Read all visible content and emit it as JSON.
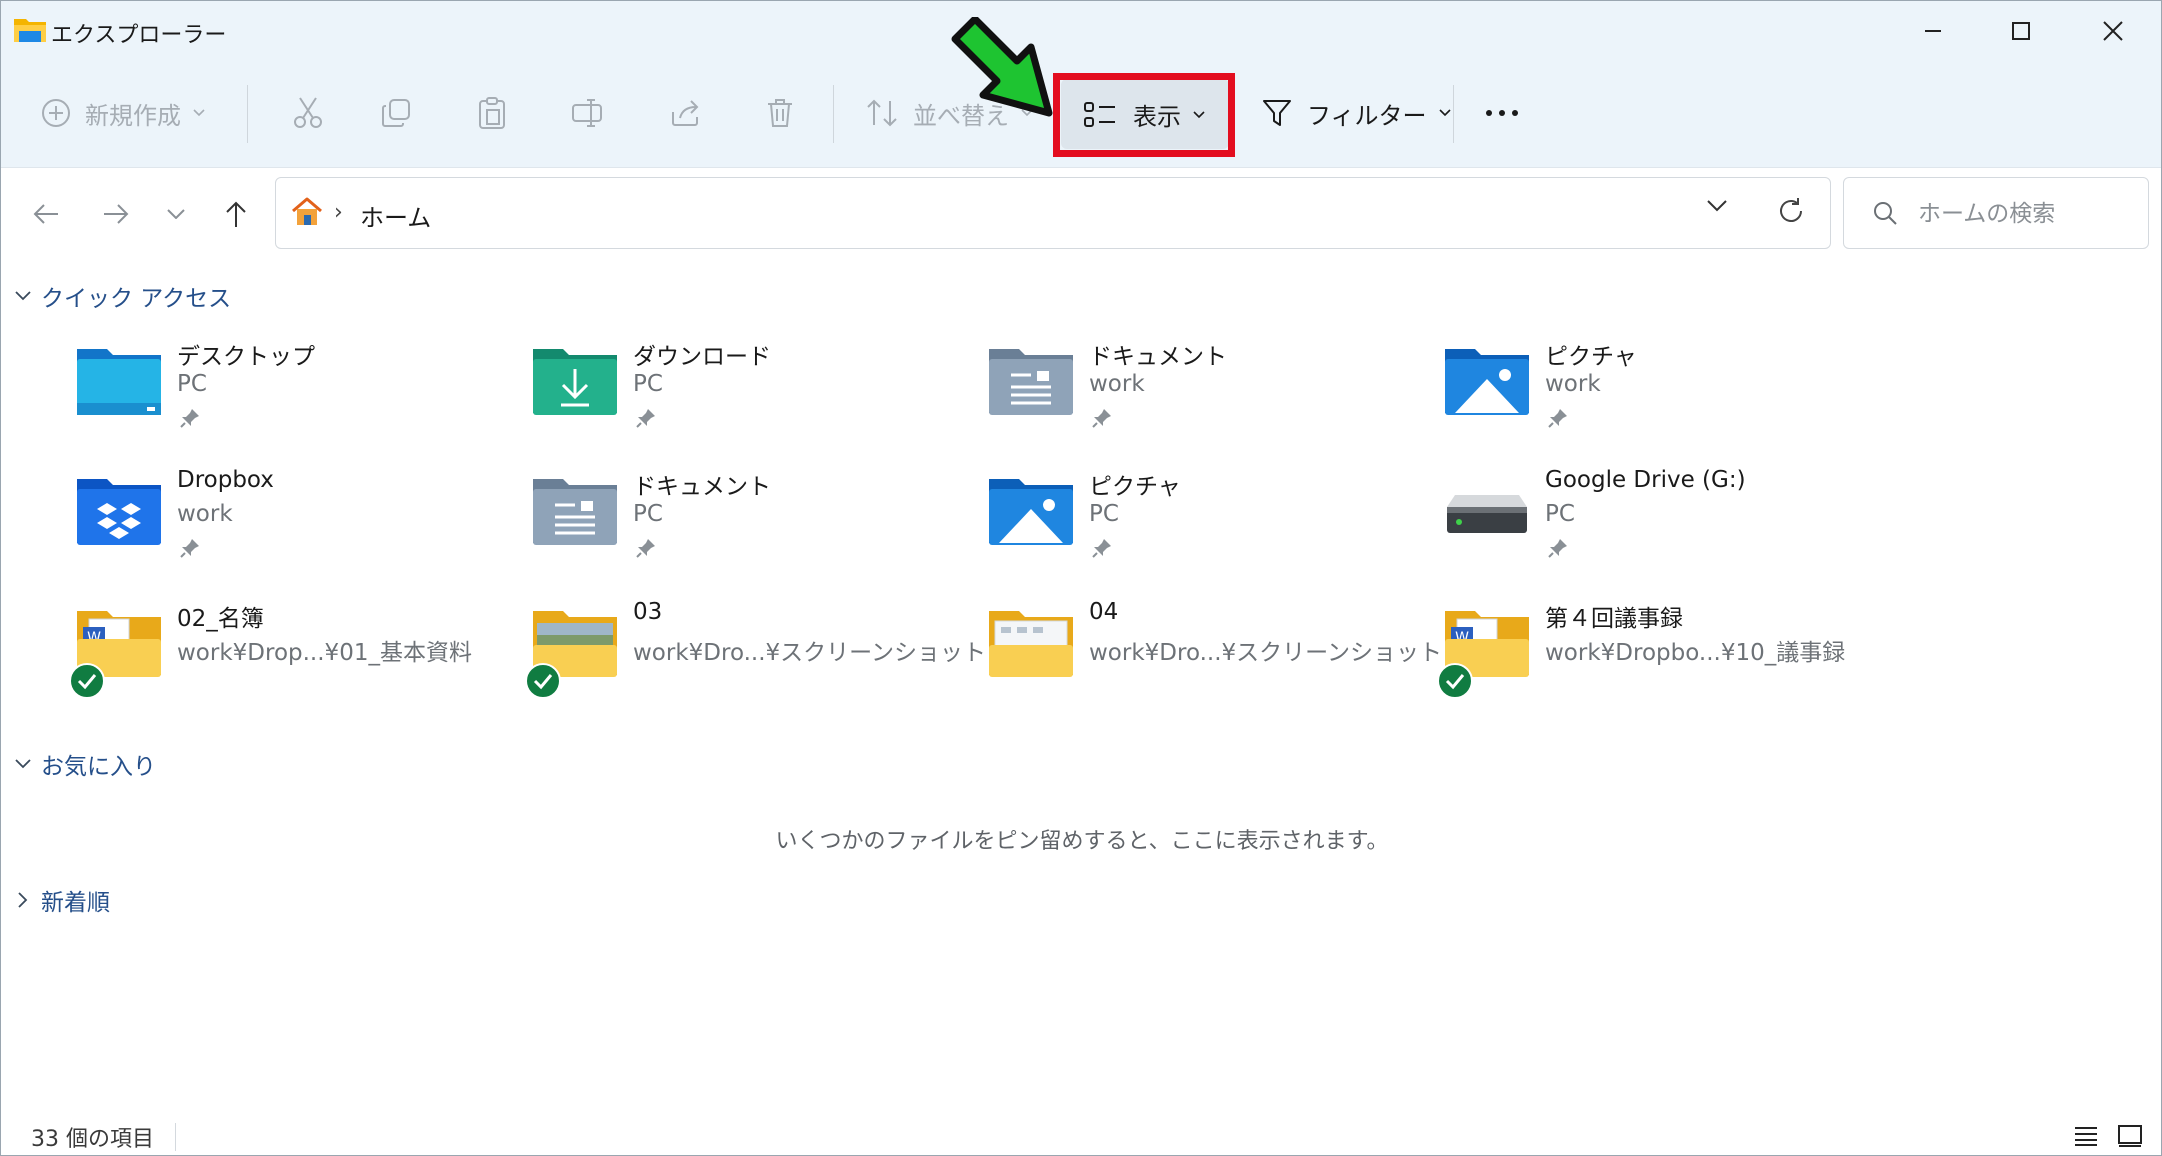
{
  "window": {
    "title": "エクスプローラー"
  },
  "toolbar": {
    "new_label": "新規作成",
    "sort_label": "並べ替え",
    "view_label": "表示",
    "filter_label": "フィルター"
  },
  "address": {
    "crumb": "ホーム"
  },
  "search": {
    "placeholder": "ホームの検索"
  },
  "quick_access": {
    "title": "クイック アクセス",
    "items": [
      {
        "name": "デスクトップ",
        "location": "PC",
        "icon": "desktop-folder"
      },
      {
        "name": "ダウンロード",
        "location": "PC",
        "icon": "downloads-folder"
      },
      {
        "name": "ドキュメント",
        "location": "work",
        "icon": "documents-folder"
      },
      {
        "name": "ピクチャ",
        "location": "work",
        "icon": "pictures-folder"
      },
      {
        "name": "Dropbox",
        "location": "work",
        "icon": "dropbox-folder"
      },
      {
        "name": "ドキュメント",
        "location": "PC",
        "icon": "documents-folder"
      },
      {
        "name": "ピクチャ",
        "location": "PC",
        "icon": "pictures-folder"
      },
      {
        "name": "Google Drive (G:)",
        "location": "PC",
        "icon": "drive"
      },
      {
        "name": "02_名簿",
        "location": "work¥Drop...¥01_基本資料",
        "icon": "word-folder"
      },
      {
        "name": "03",
        "location": "work¥Dro...¥スクリーンショット",
        "icon": "image-folder"
      },
      {
        "name": "04",
        "location": "work¥Dro...¥スクリーンショット",
        "icon": "screens-folder"
      },
      {
        "name": "第４回議事録",
        "location": "work¥Dropbo...¥10_議事録",
        "icon": "word-folder"
      }
    ]
  },
  "favorites": {
    "title": "お気に入り",
    "empty_message": "いくつかのファイルをピン留めすると、ここに表示されます。"
  },
  "recent": {
    "title": "新着順"
  },
  "status": {
    "item_count": "33 個の項目"
  },
  "colors": {
    "accent": "#0a5fb4",
    "highlight": "#e30d1f",
    "arrow": "#1ec431",
    "section": "#254f8a"
  }
}
